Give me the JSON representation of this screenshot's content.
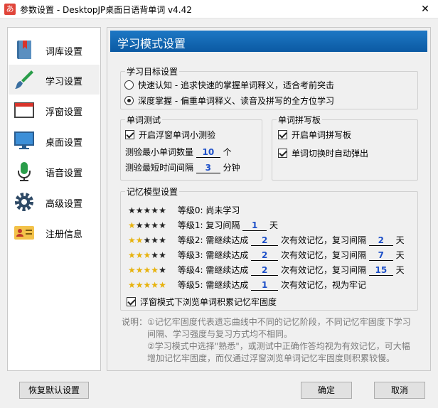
{
  "window": {
    "app_icon": "あ",
    "title": "参数设置 - DesktopJP桌面日语背单词 v4.42",
    "close": "✕"
  },
  "sidebar": {
    "items": [
      {
        "label": "词库设置",
        "icon": "book-icon"
      },
      {
        "label": "学习设置",
        "icon": "brush-icon"
      },
      {
        "label": "浮窗设置",
        "icon": "window-icon"
      },
      {
        "label": "桌面设置",
        "icon": "monitor-icon"
      },
      {
        "label": "语音设置",
        "icon": "microphone-icon"
      },
      {
        "label": "高级设置",
        "icon": "gear-icon"
      },
      {
        "label": "注册信息",
        "icon": "id-card-icon"
      }
    ],
    "active_index": 1
  },
  "main": {
    "header": "学习模式设置",
    "goal": {
      "title": "学习目标设置",
      "options": [
        {
          "label": "快速认知 - 追求快速的掌握单词释义，适合考前突击",
          "selected": false
        },
        {
          "label": "深度掌握 - 偏重单词释义、读音及拼写的全方位学习",
          "selected": true
        }
      ]
    },
    "quiz": {
      "title": "单词测试",
      "enable_label": "开启浮窗单词小测验",
      "enable_checked": true,
      "min_words_prefix": "测验最小单词数量",
      "min_words_value": "10",
      "min_words_suffix": "个",
      "min_interval_prefix": "测验最短时间间隔",
      "min_interval_value": "3",
      "min_interval_suffix": "分钟"
    },
    "spelling": {
      "title": "单词拼写板",
      "enable_label": "开启单词拼写板",
      "enable_checked": true,
      "auto_popup_label": "单词切换时自动弹出",
      "auto_popup_checked": true
    },
    "memory": {
      "title": "记忆模型设置",
      "levels": [
        {
          "stars_filled": 0,
          "text": "等级0: 尚未学习"
        },
        {
          "stars_filled": 1,
          "prefix": "等级1: 复习间隔",
          "interval": "1",
          "unit": "天"
        },
        {
          "stars_filled": 2,
          "prefix": "等级2: 需继续达成",
          "count": "2",
          "mid": "次有效记忆，复习间隔",
          "interval": "2",
          "unit": "天"
        },
        {
          "stars_filled": 3,
          "prefix": "等级3: 需继续达成",
          "count": "2",
          "mid": "次有效记忆，复习间隔",
          "interval": "7",
          "unit": "天"
        },
        {
          "stars_filled": 4,
          "prefix": "等级4: 需继续达成",
          "count": "2",
          "mid": "次有效记忆，复习间隔",
          "interval": "15",
          "unit": "天"
        },
        {
          "stars_filled": 5,
          "prefix": "等级5: 需继续达成",
          "count": "1",
          "mid": "次有效记忆，视为牢记"
        }
      ],
      "float_browse_label": "浮窗模式下浏览单词积累记忆牢固度",
      "float_browse_checked": true
    },
    "note": {
      "line1": "说明：①记忆牢固度代表遗忘曲线中不同的记忆阶段，不同记忆牢固度下学习",
      "line2": "间隔、学习强度与复习方式均不相同。",
      "line3": "②学习模式中选择\"熟悉\"，或测试中正确作答均视为有效记忆，可大幅",
      "line4": "增加记忆牢固度，而仅通过浮窗浏览单词记忆牢固度则积累较慢。"
    }
  },
  "footer": {
    "reset_label": "恢复默认设置",
    "ok_label": "确定",
    "cancel_label": "取消"
  },
  "colors": {
    "header_blue": "#0b5aa3",
    "value_blue": "#1e50c8",
    "star_gold": "#e7b20c"
  }
}
